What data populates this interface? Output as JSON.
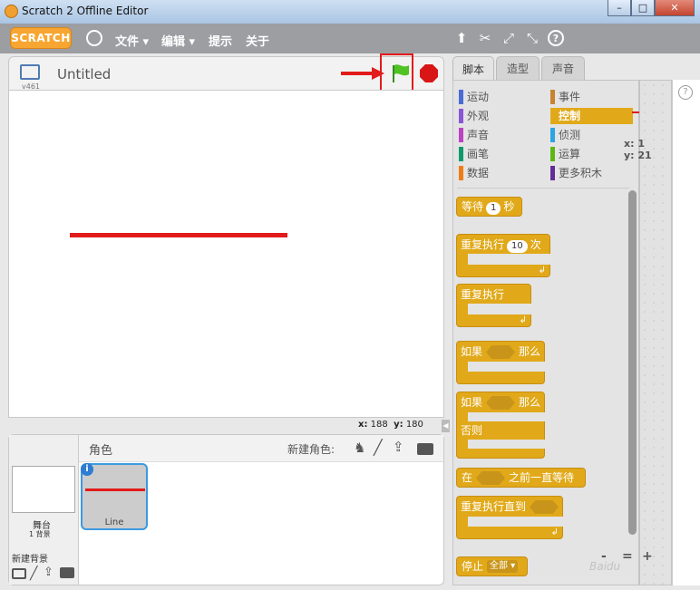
{
  "window": {
    "title": "Scratch 2 Offline Editor",
    "min": "–",
    "max": "□",
    "close": "✕"
  },
  "menubar": {
    "logo": "SCRATCH",
    "items": [
      "文件 ▾",
      "编辑 ▾",
      "提示",
      "关于"
    ],
    "tool_icons": [
      "duplicate-icon",
      "cut-icon",
      "grow-icon",
      "shrink-icon",
      "help-icon"
    ],
    "tool_glyphs": [
      "⬆",
      "✂",
      "⤢",
      "⤡",
      "?"
    ]
  },
  "stage": {
    "title": "Untitled",
    "version": "v461",
    "coord_x_label": "x:",
    "coord_x": "188",
    "coord_y_label": "y:",
    "coord_y": "180"
  },
  "sprites": {
    "header": "角色",
    "new_sprite_label": "新建角色:",
    "stage_label": "舞台",
    "stage_backdrops": "1 背景",
    "new_backdrop_label": "新建背景",
    "sprite_name": "Line"
  },
  "tabs": [
    "脚本",
    "造型",
    "声音"
  ],
  "categories": [
    {
      "label": "运动",
      "color": "#4a6cd4"
    },
    {
      "label": "事件",
      "color": "#c88330"
    },
    {
      "label": "外观",
      "color": "#8a55d7"
    },
    {
      "label": "控制",
      "color": "#e1a91a"
    },
    {
      "label": "声音",
      "color": "#bb42c3"
    },
    {
      "label": "侦测",
      "color": "#2ca5e2"
    },
    {
      "label": "画笔",
      "color": "#0e9a6c"
    },
    {
      "label": "运算",
      "color": "#5cb712"
    },
    {
      "label": "数据",
      "color": "#ee7d16"
    },
    {
      "label": "更多积木",
      "color": "#632d99"
    }
  ],
  "blocks": {
    "wait": {
      "label": "等待",
      "value": "1",
      "unit": "秒"
    },
    "repeat": {
      "label": "重复执行",
      "value": "10",
      "unit": "次"
    },
    "forever": {
      "label": "重复执行"
    },
    "if_then": {
      "label": "如果",
      "then": "那么"
    },
    "if_else": {
      "label": "如果",
      "then": "那么",
      "else": "否则"
    },
    "wait_until": {
      "label": "在",
      "suffix": "之前一直等待"
    },
    "repeat_until": {
      "label": "重复执行直到"
    },
    "stop": {
      "label": "停止",
      "option": "全部"
    }
  },
  "script_area": {
    "x_label": "x: 1",
    "y_label": "y: 21",
    "zoom": [
      "-",
      "=",
      "+"
    ]
  },
  "watermark": "Baidu"
}
